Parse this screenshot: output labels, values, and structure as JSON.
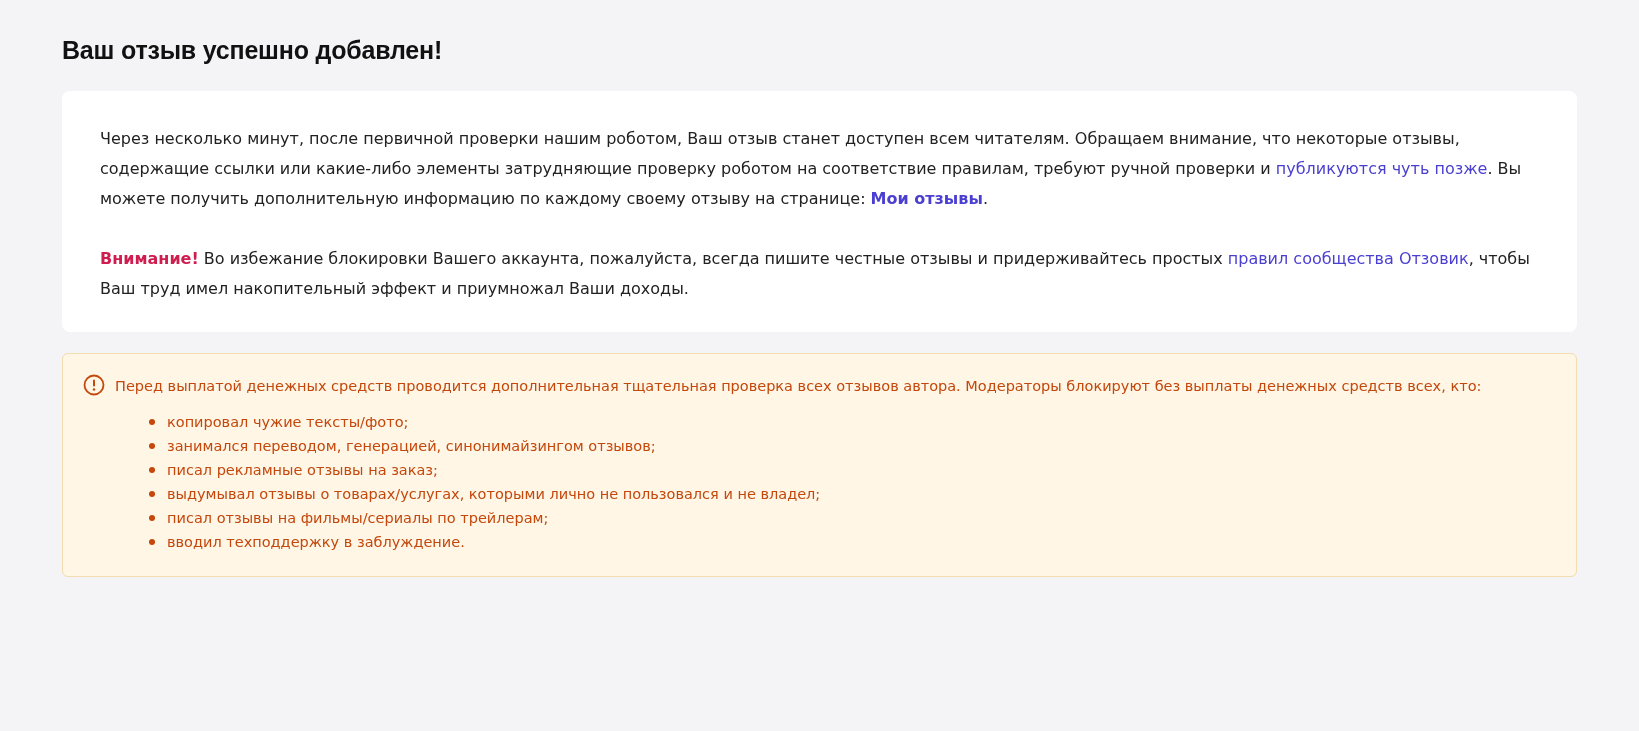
{
  "page_title": "Ваш отзыв успешно добавлен!",
  "info_card": {
    "paragraphs": [
      [
        {
          "kind": "text",
          "text": "Через несколько минут, после первичной проверки нашим роботом, Ваш отзыв станет доступен всем читателям. Обращаем внимание, что некоторые отзывы, содержащие ссылки или какие-либо элементы затрудняющие проверку роботом на соответствие правилам, требуют ручной проверки и "
        },
        {
          "kind": "link",
          "text": "публикуются чуть позже"
        },
        {
          "kind": "text",
          "text": ". Вы можете получить дополнительную информацию по каждому своему отзыву на странице: "
        },
        {
          "kind": "strong_link",
          "text": "Мои отзывы"
        },
        {
          "kind": "text",
          "text": "."
        }
      ],
      [
        {
          "kind": "alert",
          "text": "Внимание!"
        },
        {
          "kind": "text",
          "text": " Во избежание блокировки Вашего аккаунта, пожалуйста, всегда пишите честные отзывы и придерживайтесь простых "
        },
        {
          "kind": "link",
          "text": "правил сообщества Отзовик"
        },
        {
          "kind": "text",
          "text": ", чтобы Ваш труд имел накопительный эффект и приумножал Ваши доходы."
        }
      ]
    ]
  },
  "warning": {
    "text": "Перед выплатой денежных средств проводится дополнительная тщательная проверка всех отзывов автора. Модераторы блокируют без выплаты денежных средств всех, кто:",
    "items": [
      "копировал чужие тексты/фото;",
      "занимался переводом, генерацией, синонимайзингом отзывов;",
      "писал рекламные отзывы на заказ;",
      "выдумывал отзывы о товарах/услугах, которыми лично не пользовался и не владел;",
      "писал отзывы на фильмы/сериалы по трейлерам;",
      "вводил техподдержку в заблуждение."
    ]
  }
}
